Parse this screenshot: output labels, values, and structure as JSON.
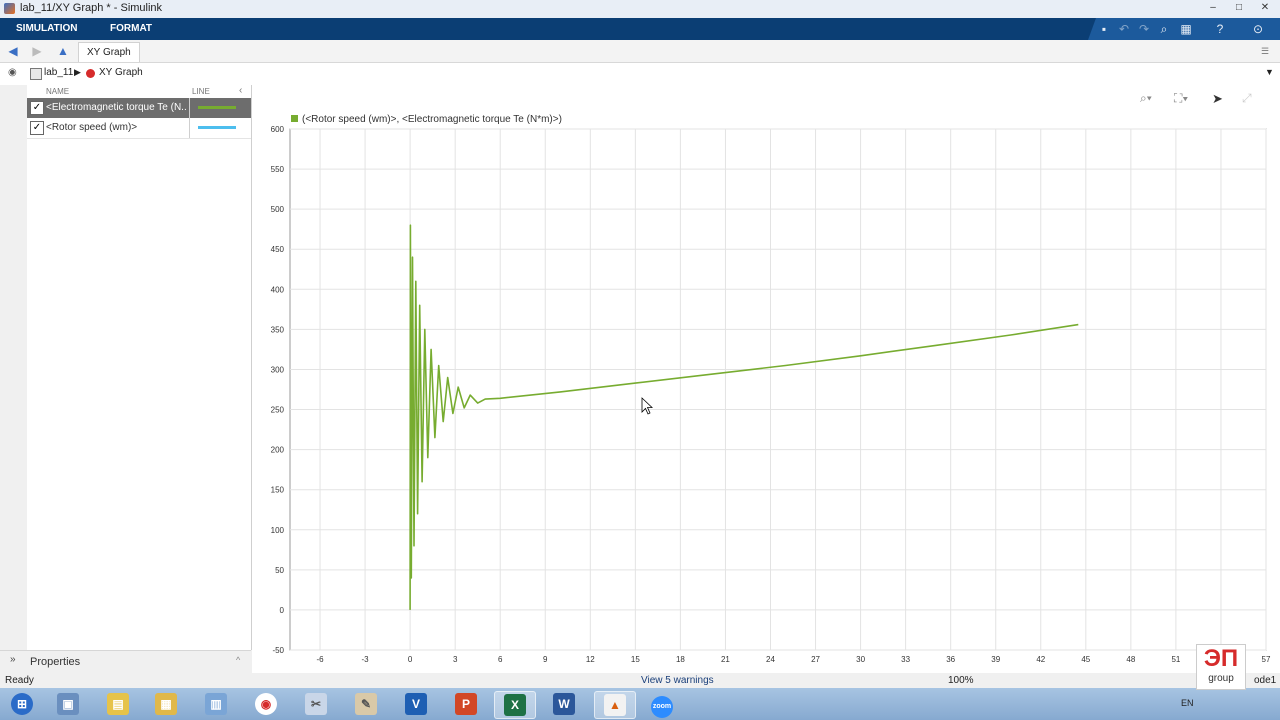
{
  "window": {
    "title": "lab_11/XY Graph * - Simulink",
    "controls": [
      "–",
      "□",
      "✕"
    ]
  },
  "toolstrip": {
    "tabs": [
      "SIMULATION",
      "FORMAT"
    ]
  },
  "nav": {
    "tab_label": "XY Graph"
  },
  "breadcrumb": {
    "model": "lab_11",
    "block": "XY Graph"
  },
  "signal_table": {
    "col_name": "NAME",
    "col_line": "LINE",
    "rows": [
      {
        "label": "<Electromagnetic torque Te (N...",
        "checked": "✓",
        "color": "#77ac30",
        "selected": true
      },
      {
        "label": "<Rotor speed (wm)>",
        "checked": "✓",
        "color": "#4dbeee",
        "selected": false
      }
    ]
  },
  "properties": {
    "label": "Properties"
  },
  "plot": {
    "legend": "(<Rotor speed (wm)>, <Electromagnetic torque Te (N*m)>)",
    "more_icon": "•••"
  },
  "chart_data": {
    "type": "line",
    "title": "",
    "xlabel": "",
    "ylabel": "",
    "xlim": [
      -8,
      57
    ],
    "ylim": [
      -50,
      600
    ],
    "x_ticks": [
      -6,
      -3,
      0,
      3,
      6,
      9,
      12,
      15,
      18,
      21,
      24,
      27,
      30,
      33,
      36,
      39,
      42,
      45,
      48,
      51,
      54,
      57
    ],
    "x_tick_labels": [
      "-6",
      "-3",
      "0",
      "3",
      "6",
      "9",
      "12",
      "15",
      "18",
      "21",
      "24",
      "27",
      "30",
      "33",
      "36",
      "39",
      "42",
      "45",
      "48",
      "51",
      "54",
      "57"
    ],
    "y_ticks": [
      -50,
      0,
      50,
      100,
      150,
      200,
      250,
      300,
      350,
      400,
      450,
      500,
      550,
      600
    ],
    "grid": true,
    "series": [
      {
        "name": "(<Rotor speed (wm)>, <Electromagnetic torque Te (N*m)>)",
        "color": "#77ac30",
        "points": [
          [
            0,
            0
          ],
          [
            0.02,
            480
          ],
          [
            0.08,
            40
          ],
          [
            0.16,
            440
          ],
          [
            0.26,
            80
          ],
          [
            0.38,
            410
          ],
          [
            0.5,
            120
          ],
          [
            0.64,
            380
          ],
          [
            0.8,
            160
          ],
          [
            0.98,
            350
          ],
          [
            1.18,
            190
          ],
          [
            1.4,
            325
          ],
          [
            1.65,
            215
          ],
          [
            1.9,
            305
          ],
          [
            2.2,
            235
          ],
          [
            2.5,
            290
          ],
          [
            2.85,
            245
          ],
          [
            3.2,
            278
          ],
          [
            3.6,
            252
          ],
          [
            4.0,
            268
          ],
          [
            4.5,
            258
          ],
          [
            5.0,
            263
          ],
          [
            6,
            264
          ],
          [
            10,
            272
          ],
          [
            15,
            283
          ],
          [
            20,
            294
          ],
          [
            25,
            305
          ],
          [
            30,
            317
          ],
          [
            35,
            330
          ],
          [
            40,
            343
          ],
          [
            44.5,
            356
          ]
        ]
      }
    ]
  },
  "status": {
    "left": "Ready",
    "center": "View 5 warnings",
    "zoom": "100%",
    "solver": "ode1"
  },
  "taskbar": {
    "apps": [
      {
        "name": "start",
        "glyph": "⊞"
      },
      {
        "name": "network",
        "glyph": "▣"
      },
      {
        "name": "folder",
        "glyph": "▤"
      },
      {
        "name": "files",
        "glyph": "▦"
      },
      {
        "name": "calc",
        "glyph": "▥"
      },
      {
        "name": "chrome",
        "glyph": "◉"
      },
      {
        "name": "snip",
        "glyph": "✂"
      },
      {
        "name": "paint",
        "glyph": "✎"
      },
      {
        "name": "outlook",
        "glyph": "V"
      },
      {
        "name": "powerpoint",
        "glyph": "P"
      },
      {
        "name": "excel",
        "glyph": "X"
      },
      {
        "name": "word",
        "glyph": "W"
      },
      {
        "name": "matlab",
        "glyph": "▲"
      },
      {
        "name": "zoom",
        "glyph": "zoom"
      }
    ],
    "lang": "EN"
  },
  "watermark": {
    "text": "ЭП",
    "sub": "group"
  }
}
